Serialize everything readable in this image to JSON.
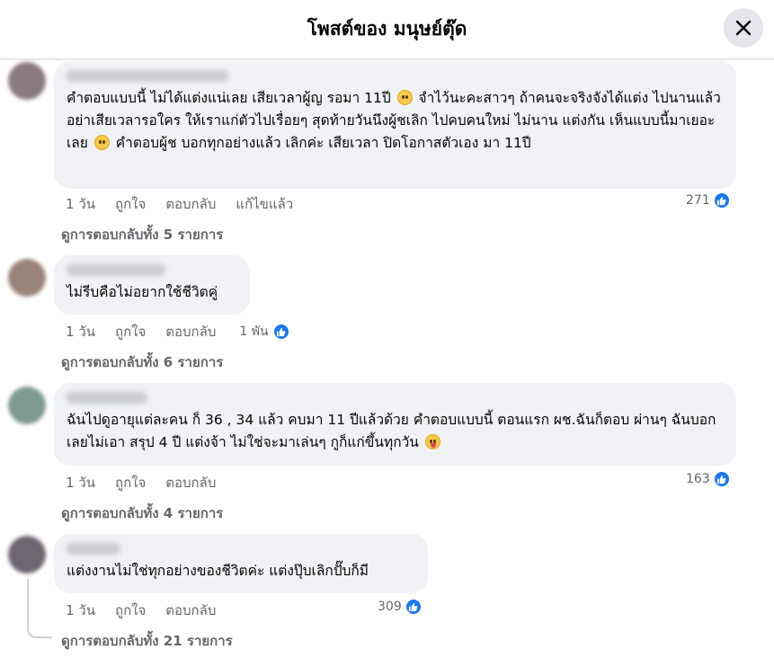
{
  "header": {
    "title": "โพสต์ของ มนุษย์ตุ๊ด"
  },
  "colors": {
    "like_blue": "#1877f2",
    "bubble_bg": "#f0f2f5",
    "meta_gray": "#65676b"
  },
  "comments": [
    {
      "text_a": "คำตอบแบบนี้ ไม่ได้แต่งแน่เลย เสียเวลาผู้ญ รอมา 11ปี",
      "text_b": "จำไว้นะคะสาวๆ ถ้าคนจะจริงจังได้แต่ง ไปนานแล้ว อย่าเสียเวลารอใคร ให้เราแก่ตัวไปเรื่อยๆ สุดท้ายวันนึงผู้ชเลิก ไปคบคนใหม่ ไม่นาน แต่งกัน เห็นแบบนี้มาเยอะเลย",
      "text_c": "คำตอบผู้ช บอกทุกอย่างแล้ว เลิกค่ะ เสียเวลา ปิดโอกาสตัวเอง มา 11ปี",
      "time": "1 วัน",
      "like": "ถูกใจ",
      "reply": "ตอบกลับ",
      "edited": "แก้ไขแล้ว",
      "reactions": "271",
      "view_replies": "ดูการตอบกลับทั้ง 5 รายการ"
    },
    {
      "text": "ไม่รีบคือไม่อยากใช้ชีวิตคู่",
      "time": "1 วัน",
      "like": "ถูกใจ",
      "reply": "ตอบกลับ",
      "reactions": "1 พัน",
      "view_replies": "ดูการตอบกลับทั้ง 6 รายการ"
    },
    {
      "text": "ฉันไปดูอายุแต่ละคน ก็ 36 , 34 แล้ว คบมา 11 ปีแล้วด้วย คำตอบแบบนี้ ตอนแรก ผช.ฉันก็ตอบ ผ่านๆ ฉันบอกเลยไม่เอา สรุป 4 ปี แต่งจ้า ไม่ใช่จะมาเล่นๆ กูก็แก่ขึ้นทุกวัน",
      "time": "1 วัน",
      "like": "ถูกใจ",
      "reply": "ตอบกลับ",
      "reactions": "163",
      "view_replies": "ดูการตอบกลับทั้ง 4 รายการ"
    },
    {
      "text": "แต่งงานไม่ใช่ทุกอย่างของชีวิตค่ะ แต่งปุ๊บเลิกปั๊บก็มี",
      "time": "1 วัน",
      "like": "ถูกใจ",
      "reply": "ตอบกลับ",
      "reactions": "309",
      "view_replies": "ดูการตอบกลับทั้ง 21 รายการ"
    }
  ]
}
